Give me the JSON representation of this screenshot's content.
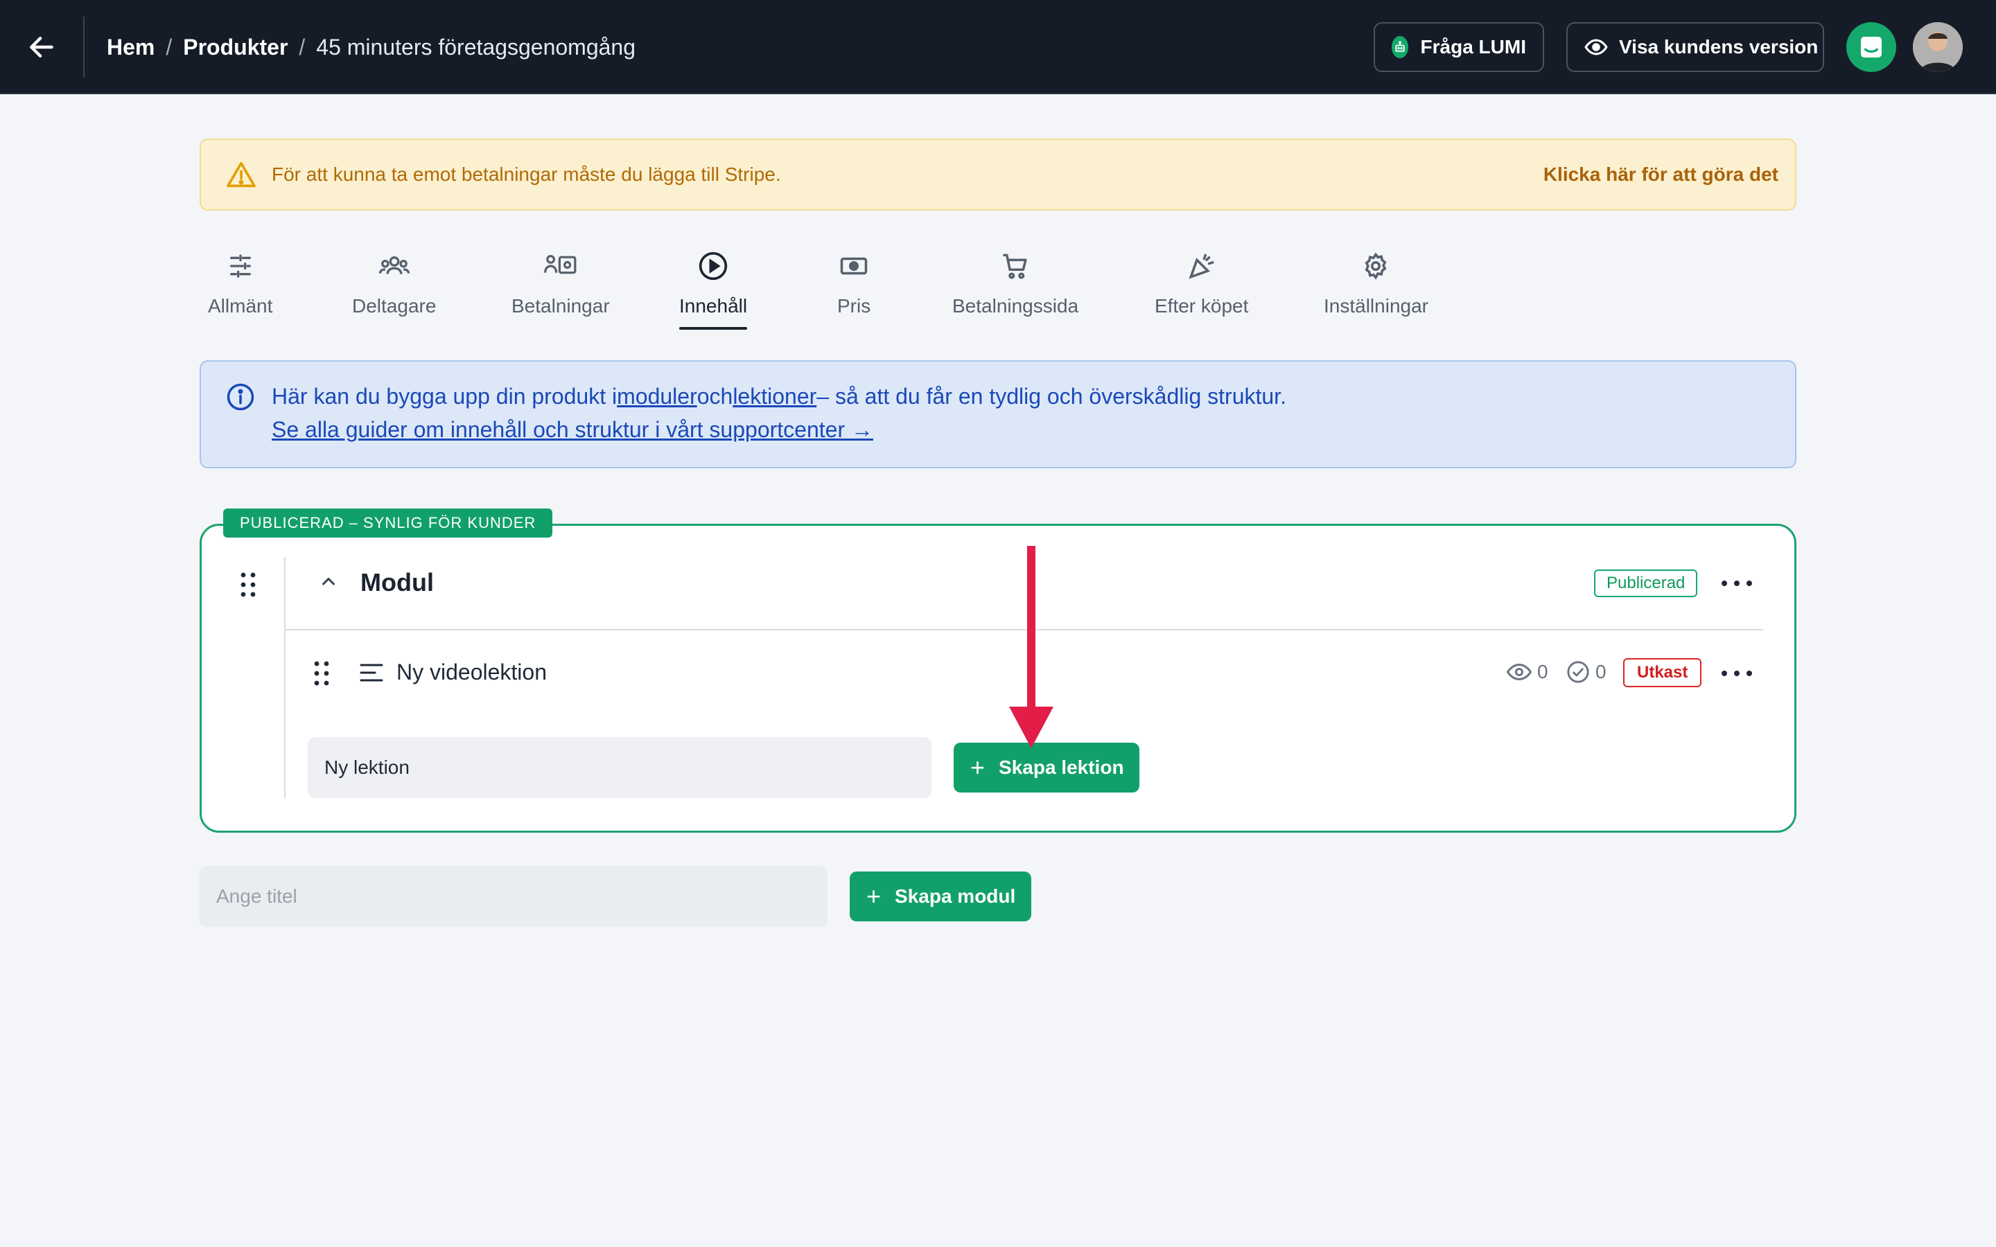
{
  "topbar": {
    "breadcrumb": [
      {
        "label": "Hem"
      },
      {
        "label": "Produkter"
      },
      {
        "label": "45 minuters företagsgenomgång"
      }
    ],
    "separator": "/",
    "ask_button_label": "Fråga LUMI",
    "preview_button_label": "Visa kundens version"
  },
  "warning": {
    "text": "För att kunna ta emot betalningar måste du lägga till Stripe.",
    "link": "Klicka här för att göra det"
  },
  "tabs": [
    {
      "label": "Allmänt",
      "icon": "sliders-icon"
    },
    {
      "label": "Deltagare",
      "icon": "users-icon"
    },
    {
      "label": "Betalningar",
      "icon": "payments-icon"
    },
    {
      "label": "Innehåll",
      "icon": "play-circle-icon",
      "active": true
    },
    {
      "label": "Pris",
      "icon": "banknote-icon"
    },
    {
      "label": "Betalningssida",
      "icon": "cart-icon"
    },
    {
      "label": "Efter köpet",
      "icon": "party-icon"
    },
    {
      "label": "Inställningar",
      "icon": "gear-icon"
    }
  ],
  "info": {
    "line1_prefix": "Här kan du bygga upp din produkt i",
    "modules_link": "moduler",
    "and_word": "och",
    "lessons_link": "lektioner",
    "line1_suffix": "– så att du får en tydlig och överskådlig struktur.",
    "line2": "Se alla guider om innehåll och struktur i vårt supportcenter →"
  },
  "module": {
    "badge": "PUBLICERAD – SYNLIG FÖR KUNDER",
    "title": "Modul",
    "status": "Publicerad",
    "lessons": [
      {
        "title": "Ny videolektion",
        "views": "0",
        "completed": "0",
        "status": "Utkast"
      }
    ],
    "new_lesson_value": "Ny lektion",
    "create_lesson_label": "Skapa lektion"
  },
  "new_module": {
    "placeholder": "Ange titel",
    "create_label": "Skapa modul"
  },
  "colors": {
    "topbar": "#151c27",
    "accent_green": "#12a06a",
    "warning_bg": "#fbf0cf",
    "info_bg": "#dce8f8",
    "draft_red": "#dc2626",
    "annotation_arrow": "#e11d48"
  }
}
